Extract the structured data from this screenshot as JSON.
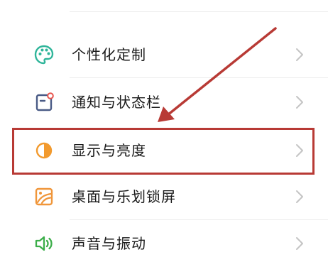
{
  "settings": {
    "items": [
      {
        "label": "个性化定制",
        "icon": "palette-icon",
        "icon_color": "#2fb59a"
      },
      {
        "label": "通知与状态栏",
        "icon": "notification-icon",
        "icon_color": "#4a5b86"
      },
      {
        "label": "显示与亮度",
        "icon": "brightness-icon",
        "icon_color": "#f29a2e"
      },
      {
        "label": "桌面与乐划锁屏",
        "icon": "wallpaper-icon",
        "icon_color": "#f0963a"
      },
      {
        "label": "声音与振动",
        "icon": "sound-icon",
        "icon_color": "#3cae4a"
      }
    ]
  },
  "annotation": {
    "highlight_color": "#b83a35",
    "highlighted_item": "显示与亮度"
  }
}
